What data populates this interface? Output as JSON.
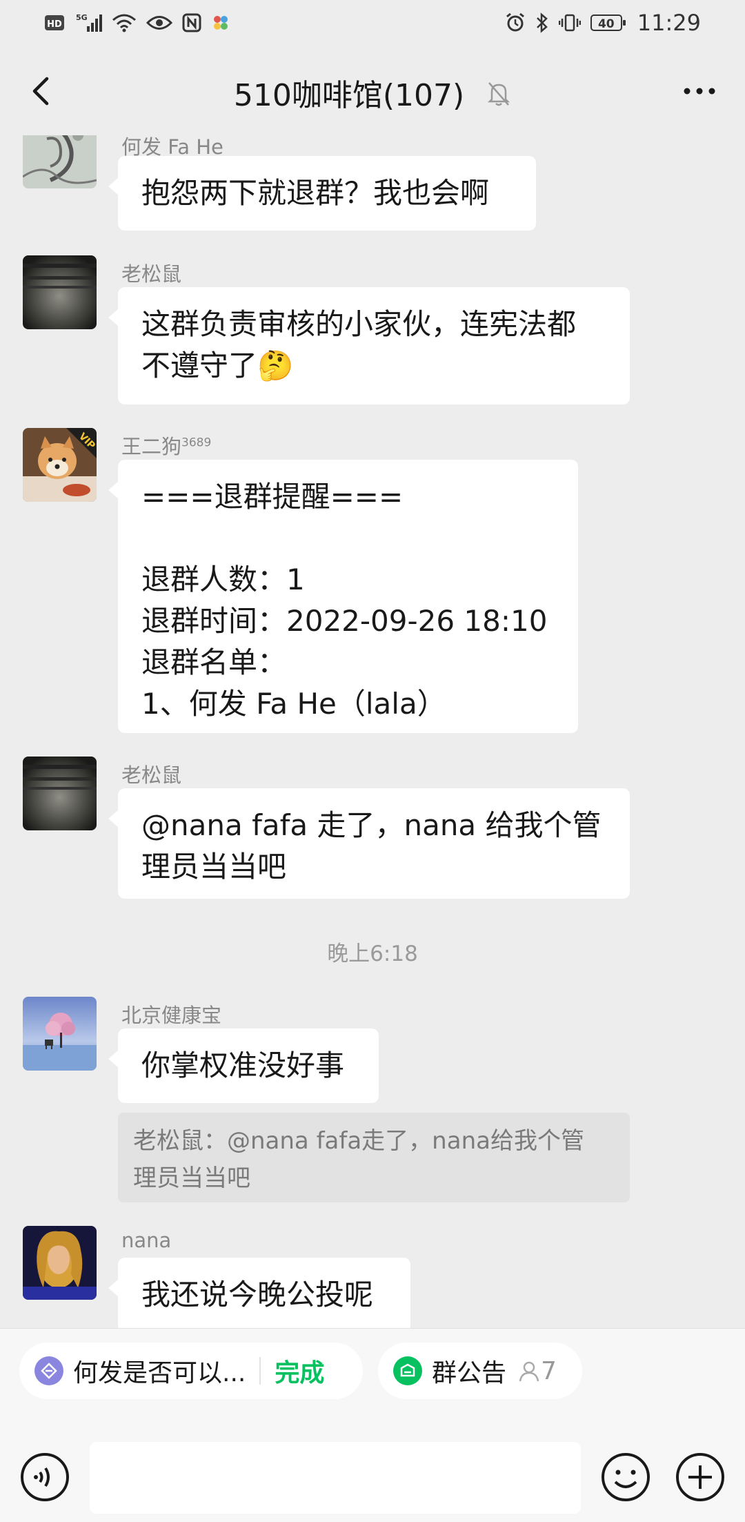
{
  "status_bar": {
    "left_icons": [
      "hd-icon",
      "5g-signal-icon",
      "wifi-icon",
      "eye-icon",
      "nfc-icon",
      "app-icon"
    ],
    "battery": "40",
    "time": "11:29"
  },
  "header": {
    "title": "510咖啡馆(107)"
  },
  "messages": [
    {
      "sender": "何发 Fa He",
      "text": "抱怨两下就退群？我也会啊"
    },
    {
      "sender": "老松鼠",
      "text": "这群负责审核的小家伙，连宪法都\n不遵守了🤔"
    },
    {
      "sender": "王二狗",
      "sender_sup": "3689",
      "text": "===退群提醒===\n\n退群人数：1\n退群时间：2022-09-26 18:10\n退群名单：\n1、何发 Fa He（lala）"
    },
    {
      "sender": "老松鼠",
      "text": "@nana fafa 走了，nana 给我个管\n理员当当吧"
    },
    {
      "sender": "北京健康宝",
      "text": "你掌权准没好事",
      "quote": "老松鼠：@nana fafa走了，nana给我个管\n理员当当吧"
    },
    {
      "sender": "nana",
      "text": "我还说今晚公投呢"
    }
  ],
  "timestamp": "晚上6:18",
  "chips": {
    "solitaire_text": "何发是否可以...",
    "solitaire_action": "完成",
    "notice_text": "群公告",
    "notice_count": "7"
  },
  "colors": {
    "background": "#ededed",
    "bubble": "#ffffff",
    "accent_green": "#07c160",
    "solitaire_icon": "#8a86e0"
  }
}
